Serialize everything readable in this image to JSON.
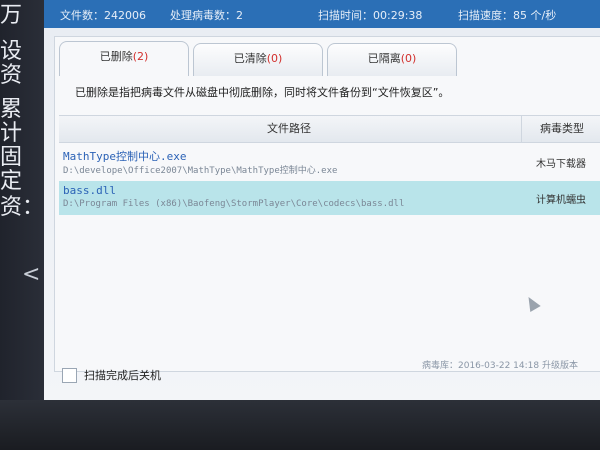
{
  "background_window": {
    "chars": [
      "万",
      "设资",
      "累计",
      "固定",
      "资："
    ],
    "arrow": "<"
  },
  "stats": {
    "file_count": "文件数：242006",
    "processed": "处理病毒数：2",
    "scan_time": "扫描时间：00:29:38",
    "scan_speed": "扫描速度：85 个/秒"
  },
  "tabs": [
    {
      "label": "已删除",
      "count": "(2)"
    },
    {
      "label": "已清除",
      "count": "(0)"
    },
    {
      "label": "已隔离",
      "count": "(0)"
    }
  ],
  "description": "已删除是指把病毒文件从磁盘中彻底删除，同时将文件备份到“文件恢复区”。",
  "table": {
    "headers": {
      "path": "文件路径",
      "virus": "病毒类型"
    },
    "rows": [
      {
        "name": "MathType控制中心.exe",
        "path": "D:\\develope\\Office2007\\MathType\\MathType控制中心.exe",
        "virus": "木马下载器"
      },
      {
        "name": "bass.dll",
        "path": "D:\\Program Files (x86)\\Baofeng\\StormPlayer\\Core\\codecs\\bass.dll",
        "virus": "计算机蠕虫"
      }
    ]
  },
  "footer": {
    "shutdown_label": "扫描完成后关机",
    "db_info": "病毒库：2016-03-22 14:18 升级版本"
  },
  "colors": {
    "accent": "#2b6fb6",
    "selected_row": "#b9e4ea",
    "count_red": "#d2302d"
  }
}
